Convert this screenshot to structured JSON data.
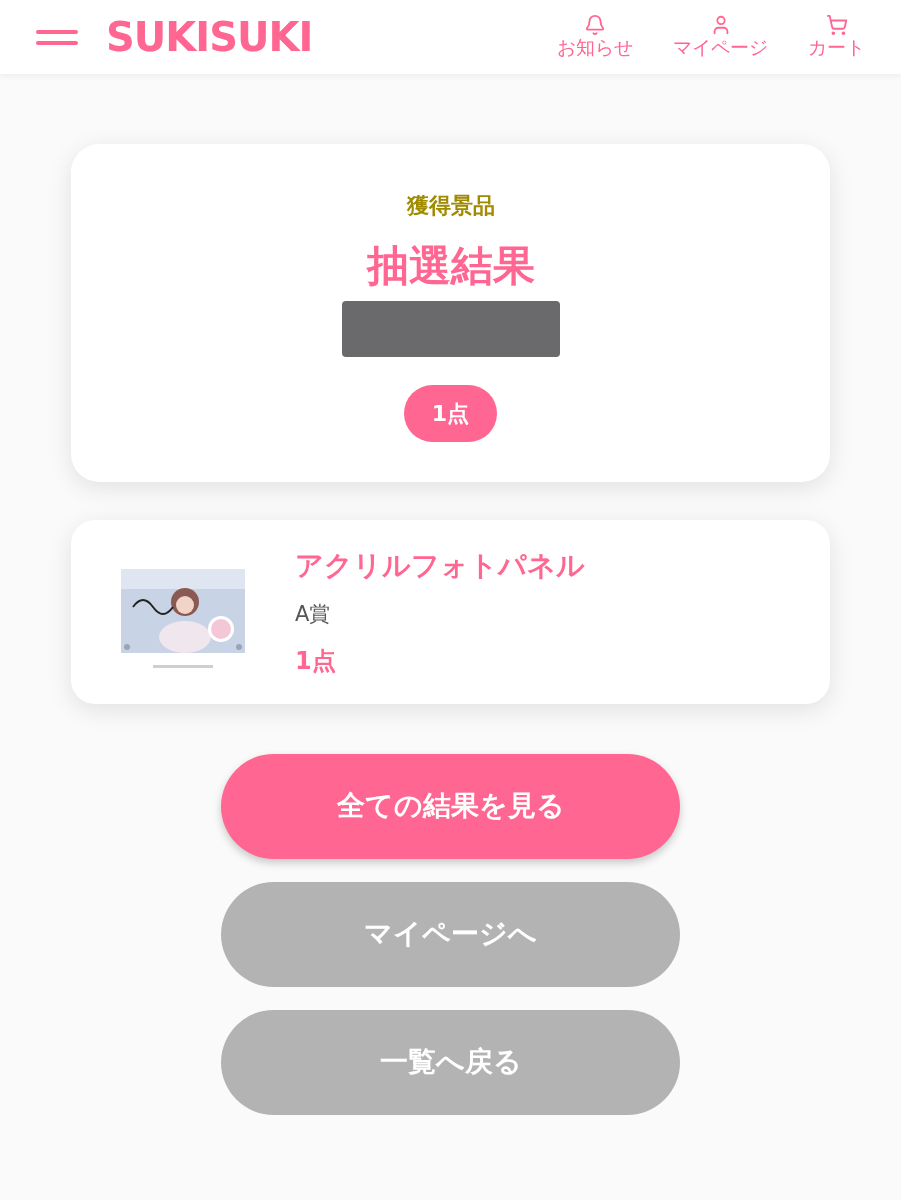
{
  "header": {
    "logo": "SUKISUKI",
    "nav": [
      {
        "label": "お知らせ",
        "kind": "bell"
      },
      {
        "label": "マイページ",
        "kind": "user"
      },
      {
        "label": "カート",
        "kind": "cart"
      }
    ]
  },
  "result_card": {
    "eyebrow": "獲得景品",
    "title": "抽選結果",
    "redacted": true,
    "count": "1点"
  },
  "prizes": [
    {
      "name": "アクリルフォトパネル",
      "rank": "A賞",
      "count": "1点"
    }
  ],
  "buttons": [
    {
      "label": "全ての結果を見る",
      "kind": "primary"
    },
    {
      "label": "マイページへ",
      "kind": "secondary"
    },
    {
      "label": "一覧へ戻る",
      "kind": "secondary"
    }
  ]
}
